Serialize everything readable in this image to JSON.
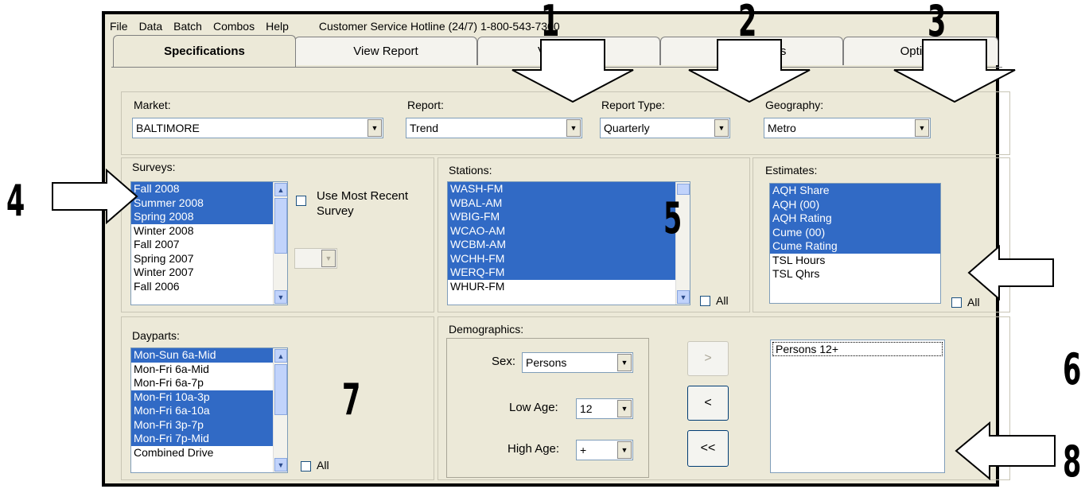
{
  "menu": {
    "items": [
      "File",
      "Data",
      "Batch",
      "Combos",
      "Help"
    ],
    "hotline": "Customer Service Hotline (24/7) 1-800-543-7300"
  },
  "tabs": [
    "Specifications",
    "View Report",
    "View Graph",
    "Print Options",
    "Options"
  ],
  "selectors": {
    "market_label": "Market:",
    "market_value": "BALTIMORE",
    "report_label": "Report:",
    "report_value": "Trend",
    "report_type_label": "Report Type:",
    "report_type_value": "Quarterly",
    "geography_label": "Geography:",
    "geography_value": "Metro"
  },
  "surveys": {
    "label": "Surveys:",
    "items": [
      {
        "text": "Fall 2008",
        "selected": true
      },
      {
        "text": "Summer 2008",
        "selected": true
      },
      {
        "text": "Spring 2008",
        "selected": true
      },
      {
        "text": "Winter 2008",
        "selected": false
      },
      {
        "text": "Fall 2007",
        "selected": false
      },
      {
        "text": "Spring 2007",
        "selected": false
      },
      {
        "text": "Winter 2007",
        "selected": false
      },
      {
        "text": "Fall 2006",
        "selected": false
      }
    ],
    "use_recent_line1": "Use Most Recent",
    "use_recent_line2": "Survey"
  },
  "stations": {
    "label": "Stations:",
    "items": [
      {
        "text": "WASH-FM",
        "selected": true
      },
      {
        "text": "WBAL-AM",
        "selected": true
      },
      {
        "text": "WBIG-FM",
        "selected": true
      },
      {
        "text": "WCAO-AM",
        "selected": true
      },
      {
        "text": "WCBM-AM",
        "selected": true
      },
      {
        "text": "WCHH-FM",
        "selected": true
      },
      {
        "text": "WERQ-FM",
        "selected": true
      },
      {
        "text": "WHUR-FM",
        "selected": false
      }
    ],
    "all_label": "All"
  },
  "estimates": {
    "label": "Estimates:",
    "items": [
      {
        "text": "AQH Share",
        "selected": true
      },
      {
        "text": "AQH (00)",
        "selected": true
      },
      {
        "text": "AQH Rating",
        "selected": true
      },
      {
        "text": "Cume (00)",
        "selected": true
      },
      {
        "text": "Cume Rating",
        "selected": true
      },
      {
        "text": "TSL Hours",
        "selected": false
      },
      {
        "text": "TSL Qhrs",
        "selected": false
      }
    ],
    "all_label": "All"
  },
  "dayparts": {
    "label": "Dayparts:",
    "items": [
      {
        "text": "Mon-Sun 6a-Mid",
        "selected": true
      },
      {
        "text": "Mon-Fri 6a-Mid",
        "selected": false
      },
      {
        "text": "Mon-Fri 6a-7p",
        "selected": false
      },
      {
        "text": "Mon-Fri 10a-3p",
        "selected": true
      },
      {
        "text": "Mon-Fri 6a-10a",
        "selected": true
      },
      {
        "text": "Mon-Fri 3p-7p",
        "selected": true
      },
      {
        "text": "Mon-Fri 7p-Mid",
        "selected": true
      },
      {
        "text": "Combined Drive",
        "selected": false
      }
    ],
    "all_label": "All"
  },
  "demographics": {
    "label": "Demographics:",
    "sex_label": "Sex:",
    "sex_value": "Persons",
    "low_age_label": "Low Age:",
    "low_age_value": "12",
    "high_age_label": "High Age:",
    "high_age_value": "+",
    "add_button": ">",
    "remove_button": "<",
    "remove_all_button": "<<",
    "selected_list": [
      "Persons 12+"
    ]
  },
  "callouts": [
    "1",
    "2",
    "3",
    "4",
    "5",
    "6",
    "7",
    "8"
  ],
  "colors": {
    "window_bg": "#ece9d8",
    "selection": "#316ac5",
    "border": "#7f9db9"
  }
}
